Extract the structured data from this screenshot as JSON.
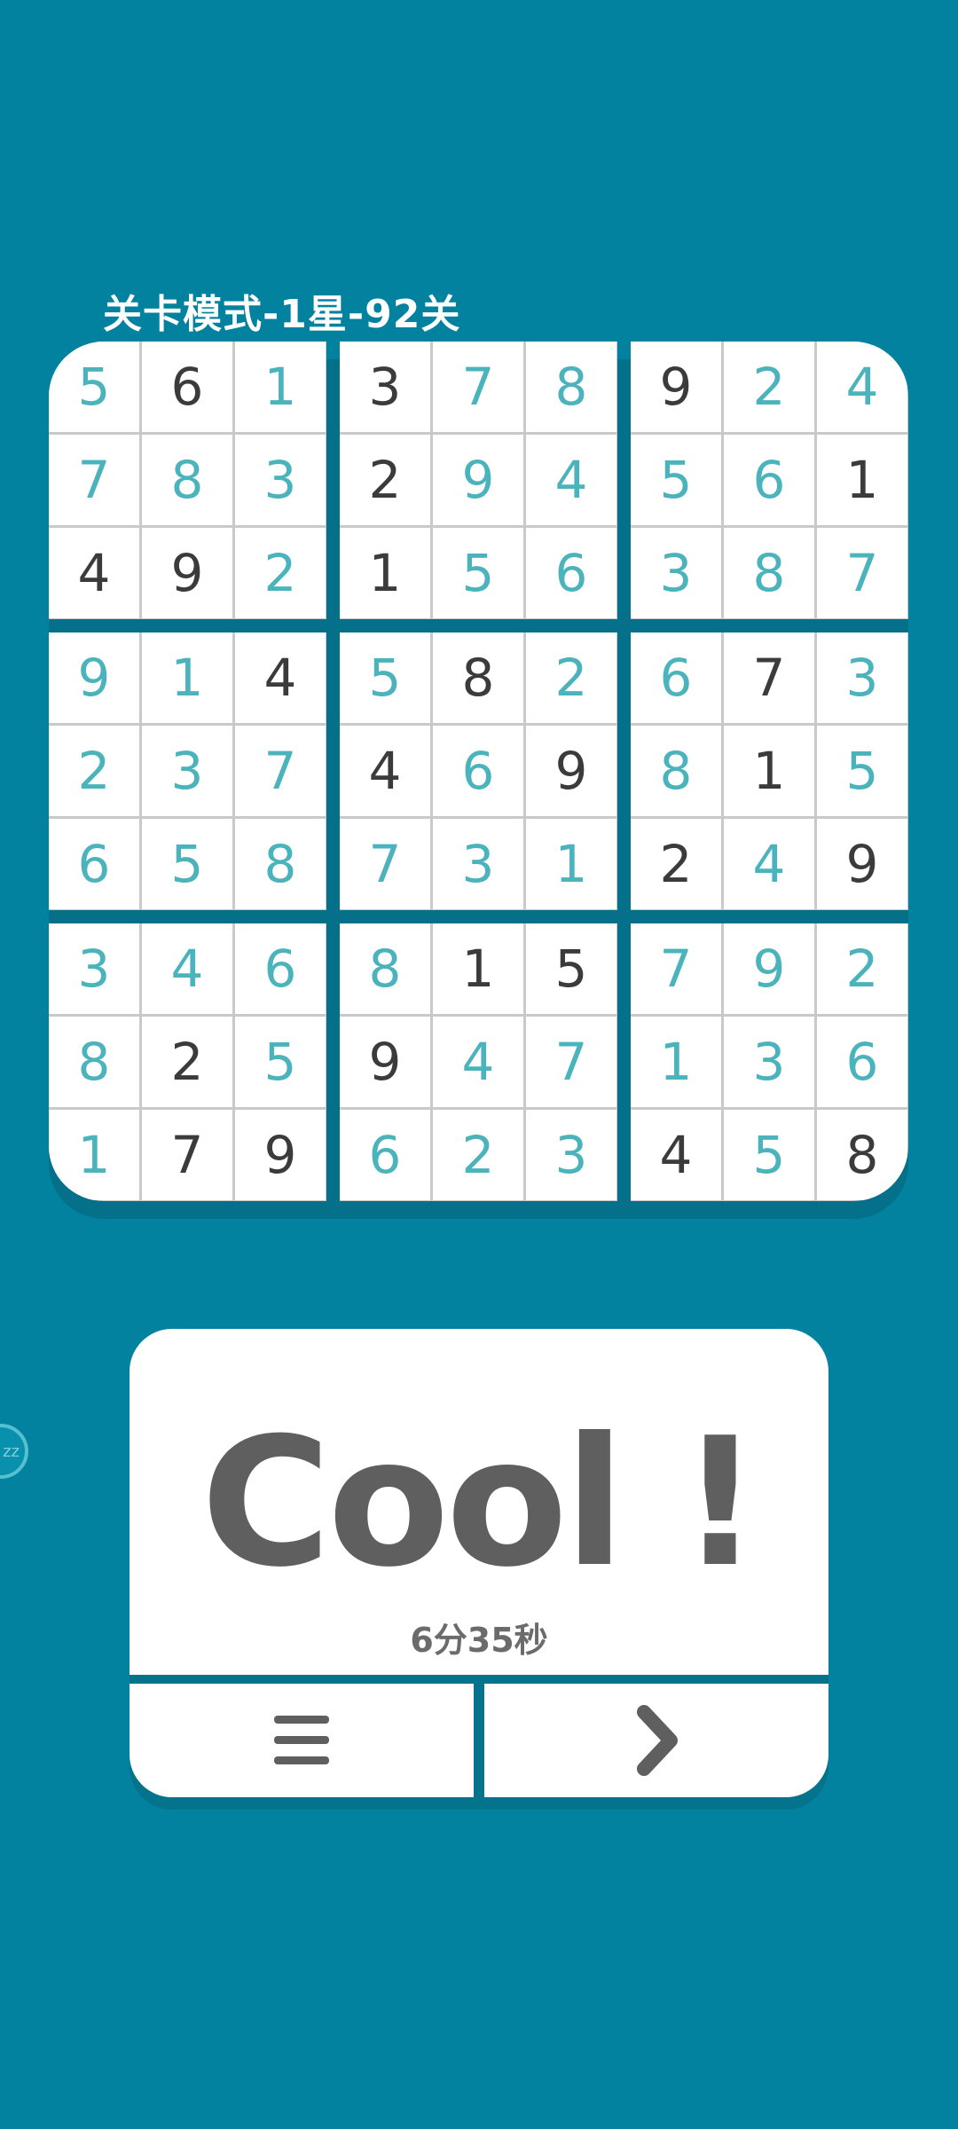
{
  "header": {
    "level_title": "关卡模式-1星-92关"
  },
  "board": {
    "grid": [
      [
        5,
        6,
        1,
        3,
        7,
        8,
        9,
        2,
        4
      ],
      [
        7,
        8,
        3,
        2,
        9,
        4,
        5,
        6,
        1
      ],
      [
        4,
        9,
        2,
        1,
        5,
        6,
        3,
        8,
        7
      ],
      [
        9,
        1,
        4,
        5,
        8,
        2,
        6,
        7,
        3
      ],
      [
        2,
        3,
        7,
        4,
        6,
        9,
        8,
        1,
        5
      ],
      [
        6,
        5,
        8,
        7,
        3,
        1,
        2,
        4,
        9
      ],
      [
        3,
        4,
        6,
        8,
        1,
        5,
        7,
        9,
        2
      ],
      [
        8,
        2,
        5,
        9,
        4,
        7,
        1,
        3,
        6
      ],
      [
        1,
        7,
        9,
        6,
        2,
        3,
        4,
        5,
        8
      ]
    ],
    "given": [
      [
        0,
        1,
        0,
        1,
        0,
        0,
        1,
        0,
        0
      ],
      [
        0,
        0,
        0,
        1,
        0,
        0,
        0,
        0,
        1
      ],
      [
        1,
        1,
        0,
        1,
        0,
        0,
        0,
        0,
        0
      ],
      [
        0,
        0,
        1,
        0,
        1,
        0,
        0,
        1,
        0
      ],
      [
        0,
        0,
        0,
        1,
        0,
        1,
        0,
        1,
        0
      ],
      [
        0,
        0,
        0,
        0,
        0,
        0,
        1,
        0,
        1
      ],
      [
        0,
        0,
        0,
        0,
        1,
        1,
        0,
        0,
        0
      ],
      [
        0,
        1,
        0,
        1,
        0,
        0,
        0,
        0,
        0
      ],
      [
        0,
        1,
        1,
        0,
        0,
        0,
        1,
        0,
        1
      ]
    ],
    "colors": {
      "given": "#3b3b3b",
      "filled": "#4ab3bb",
      "background": "#02829f",
      "cell": "#ffffff",
      "grid_line": "#c9c9c9"
    }
  },
  "result": {
    "message": "Cool !",
    "elapsed_time": "6分35秒"
  },
  "buttons": {
    "menu_icon": "menu-icon",
    "next_icon": "chevron-right-icon"
  },
  "side_tab": {
    "text": "zz"
  }
}
